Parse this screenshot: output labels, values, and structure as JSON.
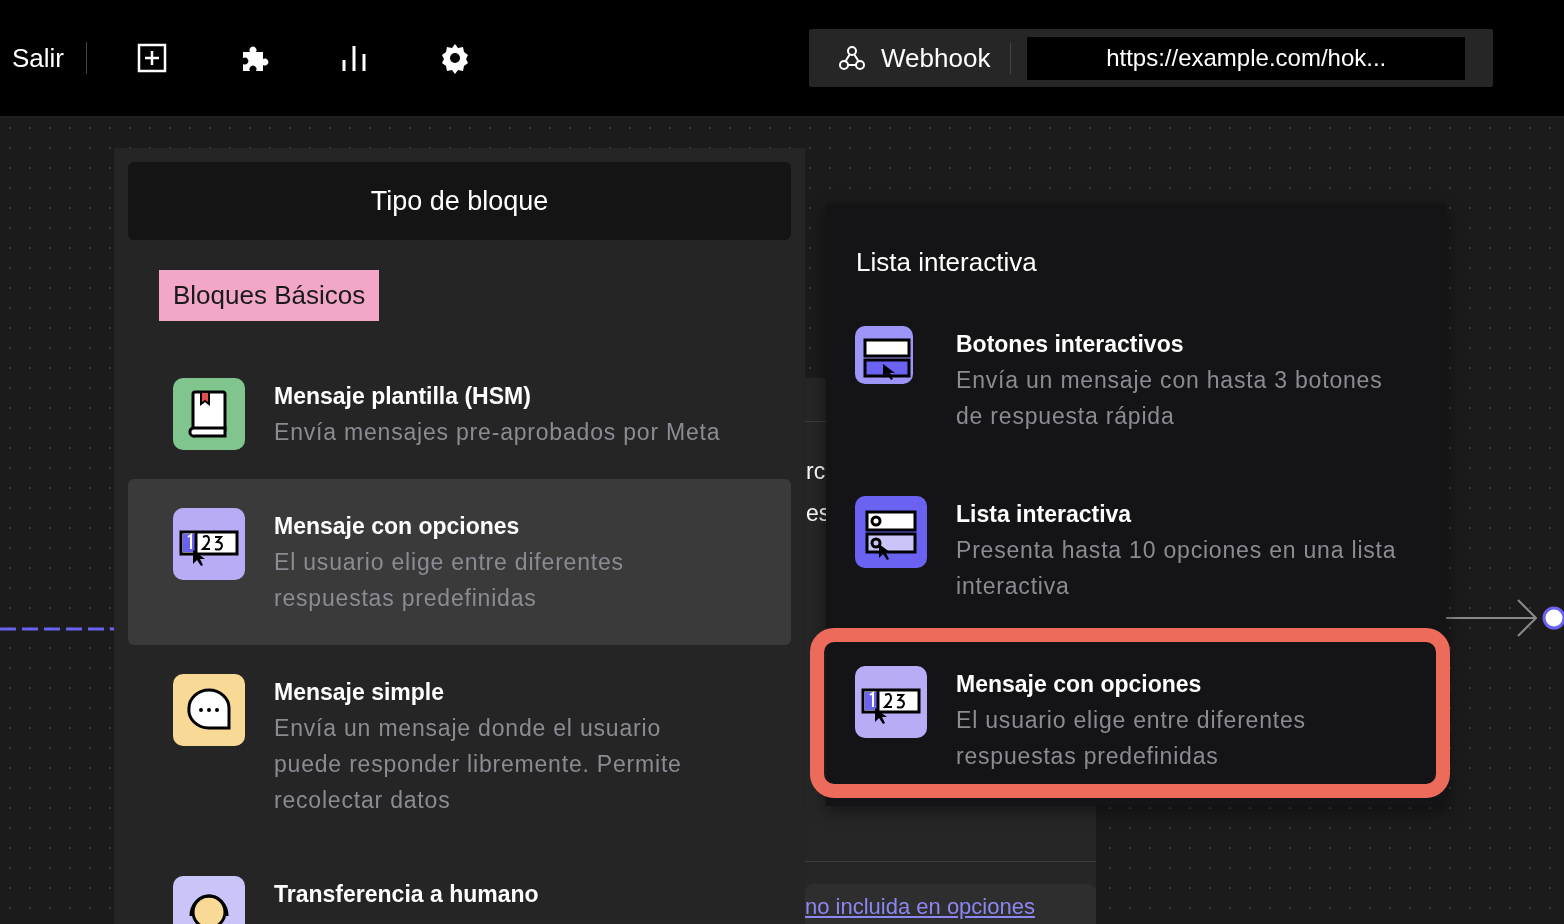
{
  "toolbar": {
    "exit_label": "Salir",
    "tools": [
      {
        "kind": "add"
      },
      {
        "kind": "plugin"
      },
      {
        "kind": "stats"
      },
      {
        "kind": "settings"
      }
    ],
    "webhook": {
      "label": "Webhook",
      "url": "https://example.com/hok..."
    }
  },
  "block_panel": {
    "title": "Tipo de bloque",
    "section": "Bloques Básicos",
    "items": [
      {
        "kind": "book",
        "title": "Mensaje plantilla (HSM)",
        "description": "Envía mensajes pre-aprobados por Meta",
        "selected": false
      },
      {
        "kind": "options",
        "title": "Mensaje con opciones",
        "description": "El usuario elige entre diferentes respuestas predefinidas",
        "selected": true
      },
      {
        "kind": "chat",
        "title": "Mensaje simple",
        "description": "Envía un mensaje donde el usuario puede responder libremente. Permite recolectar datos",
        "selected": false
      },
      {
        "kind": "human",
        "title": "Transferencia a humano",
        "selected": false
      }
    ]
  },
  "background_node": {
    "texts": [
      "rc",
      "es"
    ],
    "link": "no incluida en opciones"
  },
  "submenu": {
    "title": "Lista interactiva",
    "items": [
      {
        "kind": "buttons",
        "title": "Botones interactivos",
        "description": "Envía un mensaje con hasta 3 botones de respuesta rápida",
        "highlighted": false
      },
      {
        "kind": "list",
        "title": "Lista interactiva",
        "description": "Presenta hasta 10 opciones en una lista interactiva",
        "highlighted": false
      },
      {
        "kind": "options",
        "title": "Mensaje con opciones",
        "description": "El usuario elige entre diferentes respuestas predefinidas",
        "highlighted": true
      }
    ]
  }
}
